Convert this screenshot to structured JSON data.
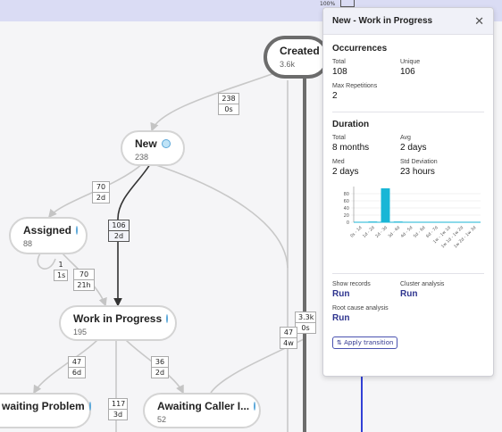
{
  "zoom": {
    "level": "100%"
  },
  "graph": {
    "nodes": {
      "created": {
        "name": "Created",
        "count": "3.6k"
      },
      "new": {
        "name": "New",
        "count": "238"
      },
      "assigned": {
        "name": "Assigned",
        "count": "88"
      },
      "wip": {
        "name": "Work in Progress",
        "count": "195"
      },
      "awaiting_problem": {
        "name": "waiting Problem"
      },
      "awaiting_caller": {
        "name": "Awaiting Caller I...",
        "count": "52"
      }
    },
    "edges": {
      "created_new": {
        "count": "238",
        "time": "0s"
      },
      "new_assigned": {
        "count": "70",
        "time": "2d"
      },
      "new_wip": {
        "count": "106",
        "time": "2d"
      },
      "assigned_loop": {
        "count": "1",
        "time": "1s"
      },
      "assigned_wip": {
        "count": "70",
        "time": "21h"
      },
      "wip_problem": {
        "count": "47",
        "time": "6d"
      },
      "wip_caller": {
        "count": "36",
        "time": "2d"
      },
      "wip_down": {
        "count": "117",
        "time": "3d"
      },
      "created_wip": {
        "count": "3.3k",
        "time": "0s"
      },
      "right_edge": {
        "count": "47",
        "time": "4w"
      }
    }
  },
  "panel": {
    "title": "New - Work in Progress",
    "close_icon": "close-icon",
    "occurrences": {
      "heading": "Occurrences",
      "total_label": "Total",
      "total_value": "108",
      "unique_label": "Unique",
      "unique_value": "106",
      "maxrep_label": "Max Repetitions",
      "maxrep_value": "2"
    },
    "duration": {
      "heading": "Duration",
      "total_label": "Total",
      "total_value": "8 months",
      "avg_label": "Avg",
      "avg_value": "2 days",
      "med_label": "Med",
      "med_value": "2 days",
      "std_label": "Std Deviation",
      "std_value": "23 hours"
    },
    "actions": {
      "show_records_label": "Show records",
      "show_records_link": "Run",
      "cluster_label": "Cluster analysis",
      "cluster_link": "Run",
      "root_cause_label": "Root cause analysis",
      "root_cause_link": "Run",
      "apply_button": "⇅ Apply transition"
    }
  },
  "chart_data": {
    "type": "bar",
    "categories": [
      "0s - 1d",
      "1d - 2d",
      "2d - 3d",
      "3d - 4d",
      "4d - 5d",
      "5d - 6d",
      "6d - 7d",
      "1w - 1w 1d",
      "1w 1d - 1w 2d",
      "1w 2d - 1w 3d"
    ],
    "values": [
      1,
      2,
      95,
      2,
      0,
      0,
      0,
      0,
      0,
      0
    ],
    "ylim": [
      0,
      100
    ],
    "yticks": [
      "0",
      "20",
      "40",
      "60",
      "80"
    ],
    "bar_color": "#19b6d6"
  }
}
